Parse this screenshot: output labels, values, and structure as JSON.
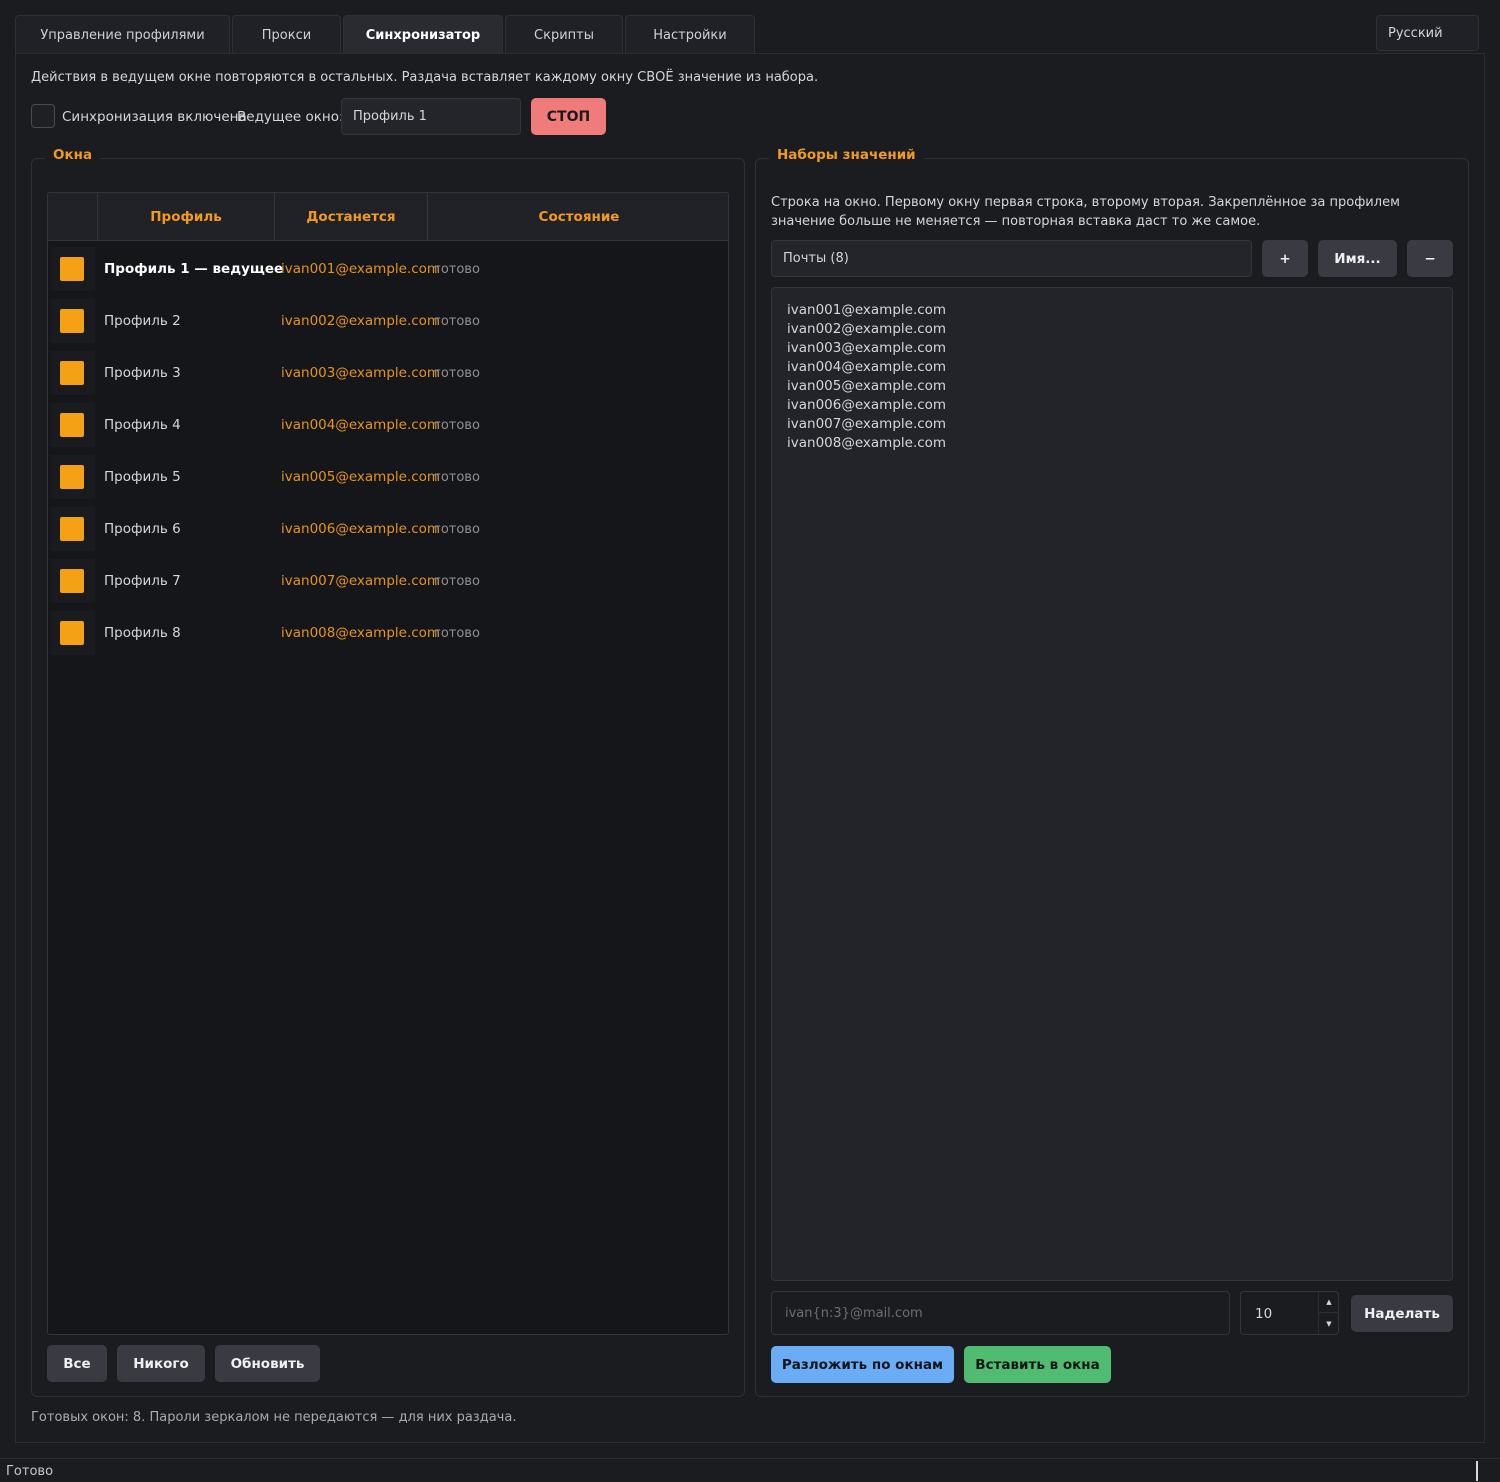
{
  "tabs": [
    {
      "label": "Управление профилями",
      "active": false
    },
    {
      "label": "Прокси",
      "active": false
    },
    {
      "label": "Синхронизатор",
      "active": true
    },
    {
      "label": "Скрипты",
      "active": false
    },
    {
      "label": "Настройки",
      "active": false
    }
  ],
  "language": "Русский",
  "description": "Действия в ведущем окне повторяются в остальных. Раздача вставляет каждому окну СВОЁ значение из набора.",
  "sync": {
    "checkbox_label": "Синхронизация включена",
    "checked": false,
    "master_label": "Ведущее окно:",
    "master_value": "Профиль 1",
    "stop_label": "СТОП"
  },
  "windows": {
    "title": "Окна",
    "columns": [
      "Профиль",
      "Достанется",
      "Состояние"
    ],
    "rows": [
      {
        "profile": "Профиль 1  — ведущее",
        "value": "ivan001@example.com",
        "state": "готово",
        "master": true
      },
      {
        "profile": "Профиль 2",
        "value": "ivan002@example.com",
        "state": "готово",
        "master": false
      },
      {
        "profile": "Профиль 3",
        "value": "ivan003@example.com",
        "state": "готово",
        "master": false
      },
      {
        "profile": "Профиль 4",
        "value": "ivan004@example.com",
        "state": "готово",
        "master": false
      },
      {
        "profile": "Профиль 5",
        "value": "ivan005@example.com",
        "state": "готово",
        "master": false
      },
      {
        "profile": "Профиль 6",
        "value": "ivan006@example.com",
        "state": "готово",
        "master": false
      },
      {
        "profile": "Профиль 7",
        "value": "ivan007@example.com",
        "state": "готово",
        "master": false
      },
      {
        "profile": "Профиль 8",
        "value": "ivan008@example.com",
        "state": "готово",
        "master": false
      }
    ],
    "buttons": {
      "all": "Все",
      "none": "Никого",
      "refresh": "Обновить"
    }
  },
  "value_sets": {
    "title": "Наборы значений",
    "help": "Строка на окно. Первому окну первая строка, второму вторая. Закреплённое за профилем значение больше не меняется — повторная вставка даст то же самое.",
    "selected_set": "Почты (8)",
    "add_label": "+",
    "rename_label": "Имя...",
    "remove_label": "−",
    "lines": [
      "ivan001@example.com",
      "ivan002@example.com",
      "ivan003@example.com",
      "ivan004@example.com",
      "ivan005@example.com",
      "ivan006@example.com",
      "ivan007@example.com",
      "ivan008@example.com"
    ],
    "template_placeholder": "ivan{n:3}@mail.com",
    "count_value": "10",
    "generate_label": "Наделать",
    "distribute_label": "Разложить по окнам",
    "paste_label": "Вставить в окна"
  },
  "footer_status": "Готовых окон: 8. Пароли зеркалом не передаются — для них раздача.",
  "bottom_status": "Готово",
  "colors": {
    "accent": "#f29a20",
    "stop": "#f07b7b",
    "distribute": "#6aacf5",
    "paste": "#4fbc72",
    "indicator": "#f5a116"
  }
}
